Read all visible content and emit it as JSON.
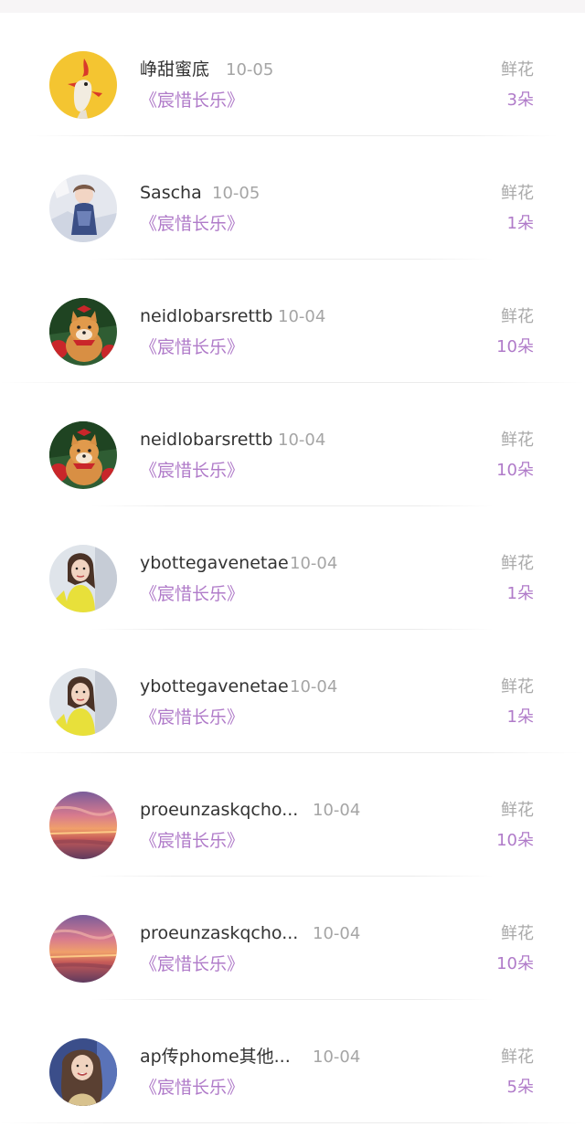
{
  "rows": [
    {
      "name": "峥甜蜜底",
      "date": "10-05",
      "song": "《宸惜长乐》",
      "gift_label": "鲜花",
      "gift_count": "3朵",
      "avatar": "yellow-deer-avatar"
    },
    {
      "name": "Sascha",
      "date": "10-05",
      "song": "《宸惜长乐》",
      "gift_label": "鲜花",
      "gift_count": "1朵",
      "avatar": "woman-photo-avatar"
    },
    {
      "name": "neidlobarsrettb",
      "date": "10-04",
      "song": "《宸惜长乐》",
      "gift_label": "鲜花",
      "gift_count": "10朵",
      "avatar": "shiba-dog-avatar"
    },
    {
      "name": "neidlobarsrettb",
      "date": "10-04",
      "song": "《宸惜长乐》",
      "gift_label": "鲜花",
      "gift_count": "10朵",
      "avatar": "shiba-dog-avatar"
    },
    {
      "name": "ybottegavenetae",
      "date": "10-04",
      "song": "《宸惜长乐》",
      "gift_label": "鲜花",
      "gift_count": "1朵",
      "avatar": "girl-yellow-avatar"
    },
    {
      "name": "ybottegavenetae",
      "date": "10-04",
      "song": "《宸惜长乐》",
      "gift_label": "鲜花",
      "gift_count": "1朵",
      "avatar": "girl-yellow-avatar"
    },
    {
      "name": "proeunzaskqcho...",
      "date": "10-04",
      "song": "《宸惜长乐》",
      "gift_label": "鲜花",
      "gift_count": "10朵",
      "avatar": "sunset-avatar"
    },
    {
      "name": "proeunzaskqcho...",
      "date": "10-04",
      "song": "《宸惜长乐》",
      "gift_label": "鲜花",
      "gift_count": "10朵",
      "avatar": "sunset-avatar"
    },
    {
      "name": "ap传phome其他...",
      "date": "10-04",
      "song": "《宸惜长乐》",
      "gift_label": "鲜花",
      "gift_count": "5朵",
      "avatar": "woman-portrait-avatar"
    }
  ],
  "colors": {
    "accent": "#b07bc9",
    "name_text": "#333333",
    "meta_text": "#a5a5a5",
    "divider": "#ebebeb",
    "top_band": "#f7f5f6"
  }
}
